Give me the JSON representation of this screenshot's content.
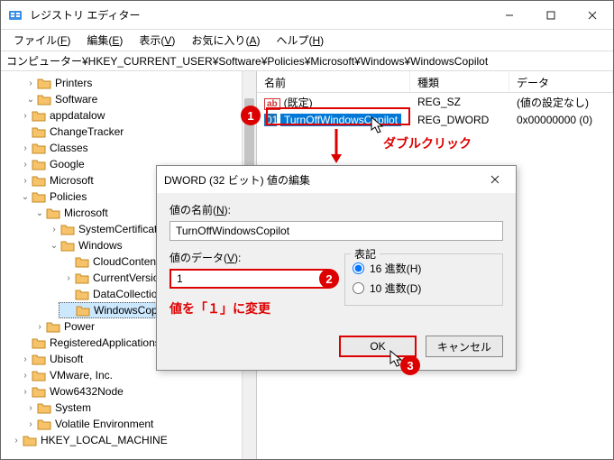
{
  "window": {
    "title": "レジストリ エディター"
  },
  "menubar": [
    {
      "label": "ファイル",
      "key": "F"
    },
    {
      "label": "編集",
      "key": "E"
    },
    {
      "label": "表示",
      "key": "V"
    },
    {
      "label": "お気に入り",
      "key": "A"
    },
    {
      "label": "ヘルプ",
      "key": "H"
    }
  ],
  "address": "コンピューター¥HKEY_CURRENT_USER¥Software¥Policies¥Microsoft¥Windows¥WindowsCopilot",
  "tree": {
    "items": [
      "Printers",
      "Software",
      "appdatalow",
      "ChangeTracker",
      "Classes",
      "Google",
      "Microsoft",
      "Policies",
      "Microsoft",
      "SystemCertificates",
      "Windows",
      "CloudContent",
      "CurrentVersion",
      "DataCollection",
      "WindowsCopilot",
      "Power",
      "RegisteredApplications",
      "Ubisoft",
      "VMware, Inc.",
      "Wow6432Node",
      "System",
      "Volatile Environment",
      "HKEY_LOCAL_MACHINE"
    ]
  },
  "list": {
    "columns": {
      "name": "名前",
      "type": "種類",
      "data": "データ"
    },
    "rows": [
      {
        "name": "(既定)",
        "type": "REG_SZ",
        "data": "(値の設定なし)",
        "icon": "ab"
      },
      {
        "name": "TurnOffWindowsCopilot",
        "type": "REG_DWORD",
        "data": "0x00000000 (0)",
        "icon": "dword",
        "selected": true
      }
    ]
  },
  "dialog": {
    "title": "DWORD (32 ビット) 値の編集",
    "name_label": "値の名前(",
    "name_key": "N",
    "name_label2": "):",
    "name_value": "TurnOffWindowsCopilot",
    "data_label": "値のデータ(",
    "data_key": "V",
    "data_label2": "):",
    "data_value": "1",
    "base_label": "表記",
    "hex_label": "16 進数(",
    "hex_key": "H",
    "hex_label2": ")",
    "dec_label": "10 進数(",
    "dec_key": "D",
    "dec_label2": ")",
    "ok": "OK",
    "cancel": "キャンセル"
  },
  "annotations": {
    "n1": "1",
    "n2": "2",
    "n3": "3",
    "dblclick": "ダブルクリック",
    "changeto1": "値を「１」に変更"
  }
}
